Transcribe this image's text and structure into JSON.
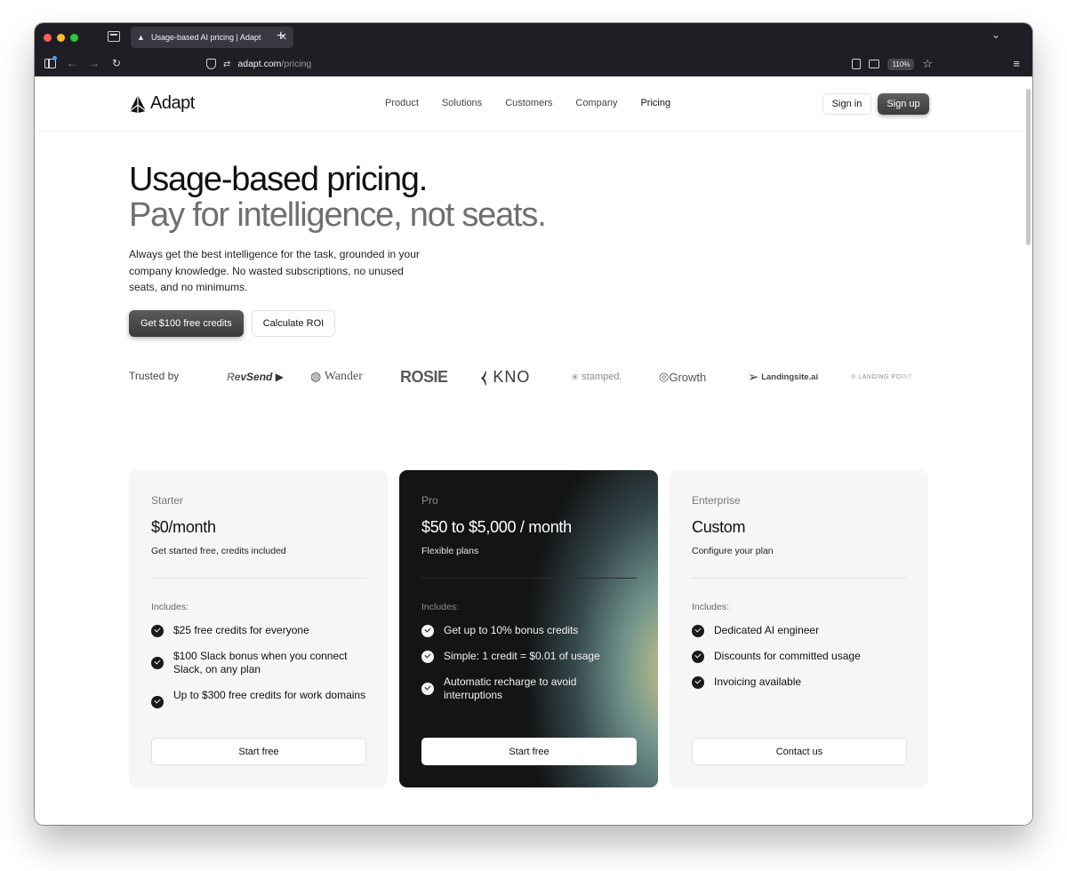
{
  "browser": {
    "tab_title": "Usage-based AI pricing | Adapt",
    "url_domain": "adapt.com",
    "url_path": "/pricing",
    "zoom": "110%"
  },
  "header": {
    "logo_text": "Adapt",
    "nav": [
      "Product",
      "Solutions",
      "Customers",
      "Company",
      "Pricing"
    ],
    "signin_label": "Sign in",
    "signup_label": "Sign up"
  },
  "hero": {
    "title": "Usage-based pricing.",
    "subtitle": "Pay for intelligence, not seats.",
    "body": "Always get the best intelligence for the task, grounded in your company knowledge. No wasted subscriptions, no unused seats, and no minimums.",
    "cta_primary": "Get $100 free credits",
    "cta_secondary": "Calculate ROI"
  },
  "trusted": {
    "label": "Trusted by",
    "logos": [
      "RevSend",
      "Wander",
      "ROSIE",
      "KNO",
      "stamped.",
      "Growth",
      "Landingsite.ai",
      "LANDING POINT"
    ]
  },
  "plans": [
    {
      "name": "Starter",
      "price": "$0/month",
      "description": "Get started free, credits included",
      "includes_label": "Includes:",
      "features": [
        "$25 free credits for everyone",
        "$100 Slack bonus when you connect Slack, on any plan",
        "Up to $300 free credits for work domains"
      ],
      "cta": "Start free"
    },
    {
      "name": "Pro",
      "price": "$50 to $5,000 / month",
      "description": "Flexible plans",
      "includes_label": "Includes:",
      "features": [
        "Get up to 10% bonus credits",
        "Simple: 1 credit = $0.01 of usage",
        "Automatic recharge to avoid interruptions"
      ],
      "cta": "Start free"
    },
    {
      "name": "Enterprise",
      "price": "Custom",
      "description": "Configure your plan",
      "includes_label": "Includes:",
      "features": [
        "Dedicated AI engineer",
        "Discounts for committed usage",
        "Invoicing available"
      ],
      "cta": "Contact us"
    }
  ]
}
